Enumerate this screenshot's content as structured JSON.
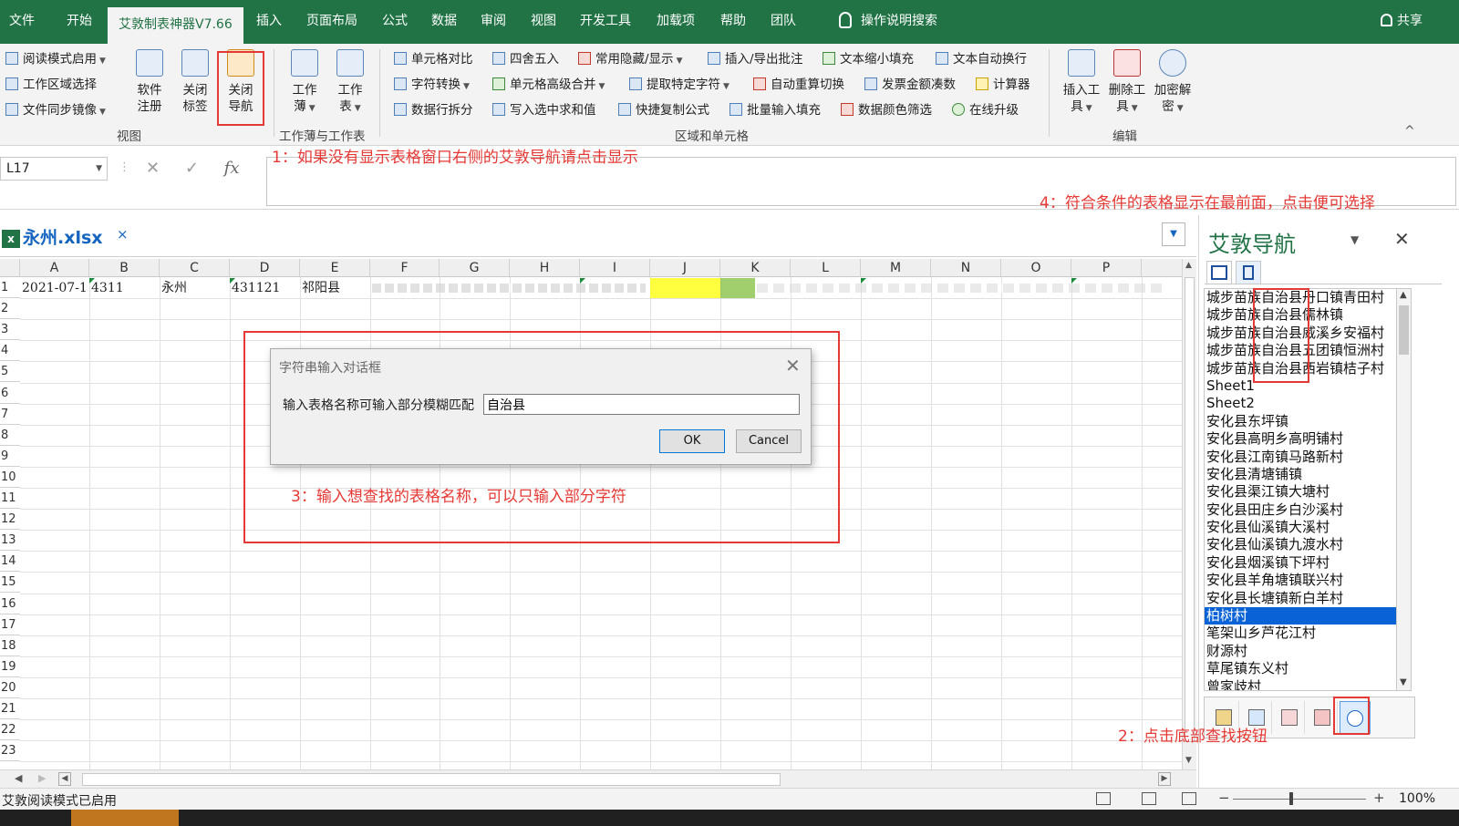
{
  "tabs": [
    "文件",
    "开始",
    "艾敦制表神器V7.66",
    "插入",
    "页面布局",
    "公式",
    "数据",
    "审阅",
    "视图",
    "开发工具",
    "加载项",
    "帮助",
    "团队"
  ],
  "tell_me": "操作说明搜索",
  "share": "共享",
  "ribbon": {
    "view_group": {
      "read_mode": "阅读模式启用",
      "work_area": "工作区域选择",
      "file_sync": "文件同步镜像",
      "software_register": [
        "软件",
        "注册"
      ],
      "close_tabs": [
        "关闭",
        "标签"
      ],
      "close_nav": [
        "关闭",
        "导航"
      ],
      "label": "视图"
    },
    "workbook_group": {
      "workbook": [
        "工作",
        "薄"
      ],
      "worksheet": [
        "工作",
        "表"
      ],
      "label": "工作薄与工作表"
    },
    "range_group": {
      "row1": [
        "单元格对比",
        "四舍五入",
        "常用隐藏/显示",
        "插入/导出批注",
        "文本缩小填充",
        "文本自动换行"
      ],
      "row2": [
        "字符转换",
        "单元格高级合并",
        "提取特定字符",
        "自动重算切换",
        "发票金额凑数",
        "计算器"
      ],
      "row3": [
        "数据行拆分",
        "写入选中求和值",
        "快捷复制公式",
        "批量输入填充",
        "数据颜色筛选",
        "在线升级"
      ],
      "label": "区域和单元格"
    },
    "edit_group": {
      "insert_tool": [
        "插入工",
        "具"
      ],
      "delete_tool": [
        "删除工",
        "具"
      ],
      "encrypt": [
        "加密解",
        "密"
      ],
      "label": "编辑"
    }
  },
  "formula_bar": {
    "name_box": "L17",
    "fx": "fx",
    "formula": ""
  },
  "annotations": {
    "note1": "1：如果没有显示表格窗口右侧的艾敦导航请点击显示",
    "note2": "2：点击底部查找按钮",
    "note3": "3：输入想查找的表格名称，可以只输入部分字符",
    "note4": "4：符合条件的表格显示在最前面，点击便可选择"
  },
  "workbook_tab": {
    "name": "永州.xlsx",
    "close": "×"
  },
  "grid": {
    "columns": [
      "A",
      "B",
      "C",
      "D",
      "E",
      "F",
      "G",
      "H",
      "I",
      "J",
      "K",
      "L",
      "M",
      "N",
      "O",
      "P"
    ],
    "rows": [
      "1",
      "2",
      "3",
      "4",
      "5",
      "6",
      "7",
      "8",
      "9",
      "10",
      "11",
      "12",
      "13",
      "14",
      "15",
      "16",
      "17",
      "18",
      "19",
      "20",
      "21",
      "22",
      "23"
    ],
    "row1": {
      "A": "2021-07-1",
      "B": "4311",
      "C": "永州",
      "D": "431121",
      "E": "祁阳县"
    }
  },
  "dialog": {
    "title": "字符串输入对话框",
    "label": "输入表格名称可输入部分模糊匹配",
    "value": "自治县",
    "ok": "OK",
    "cancel": "Cancel"
  },
  "nav": {
    "title": "艾敦导航",
    "items": [
      "城步苗族自治县丹口镇青田村",
      "城步苗族自治县儒林镇",
      "城步苗族自治县威溪乡安福村",
      "城步苗族自治县五团镇恒洲村",
      "城步苗族自治县西岩镇桔子村",
      "Sheet1",
      "Sheet2",
      "安化县东坪镇",
      "安化县高明乡高明铺村",
      "安化县江南镇马路新村",
      "安化县清塘铺镇",
      "安化县渠江镇大塘村",
      "安化县田庄乡白沙溪村",
      "安化县仙溪镇大溪村",
      "安化县仙溪镇九渡水村",
      "安化县烟溪镇下坪村",
      "安化县羊角塘镇联兴村",
      "安化县长塘镇新白羊村",
      "柏树村",
      "笔架山乡芦花江村",
      "财源村",
      "草尾镇东义村",
      "曾家歧村"
    ],
    "selected_index": 18
  },
  "status": {
    "text": "艾敦阅读模式已启用",
    "zoom": "100%"
  },
  "colors": {
    "accent": "#217346",
    "annotation": "#e53935",
    "selection": "#0a63d6",
    "link": "#1565c0"
  }
}
